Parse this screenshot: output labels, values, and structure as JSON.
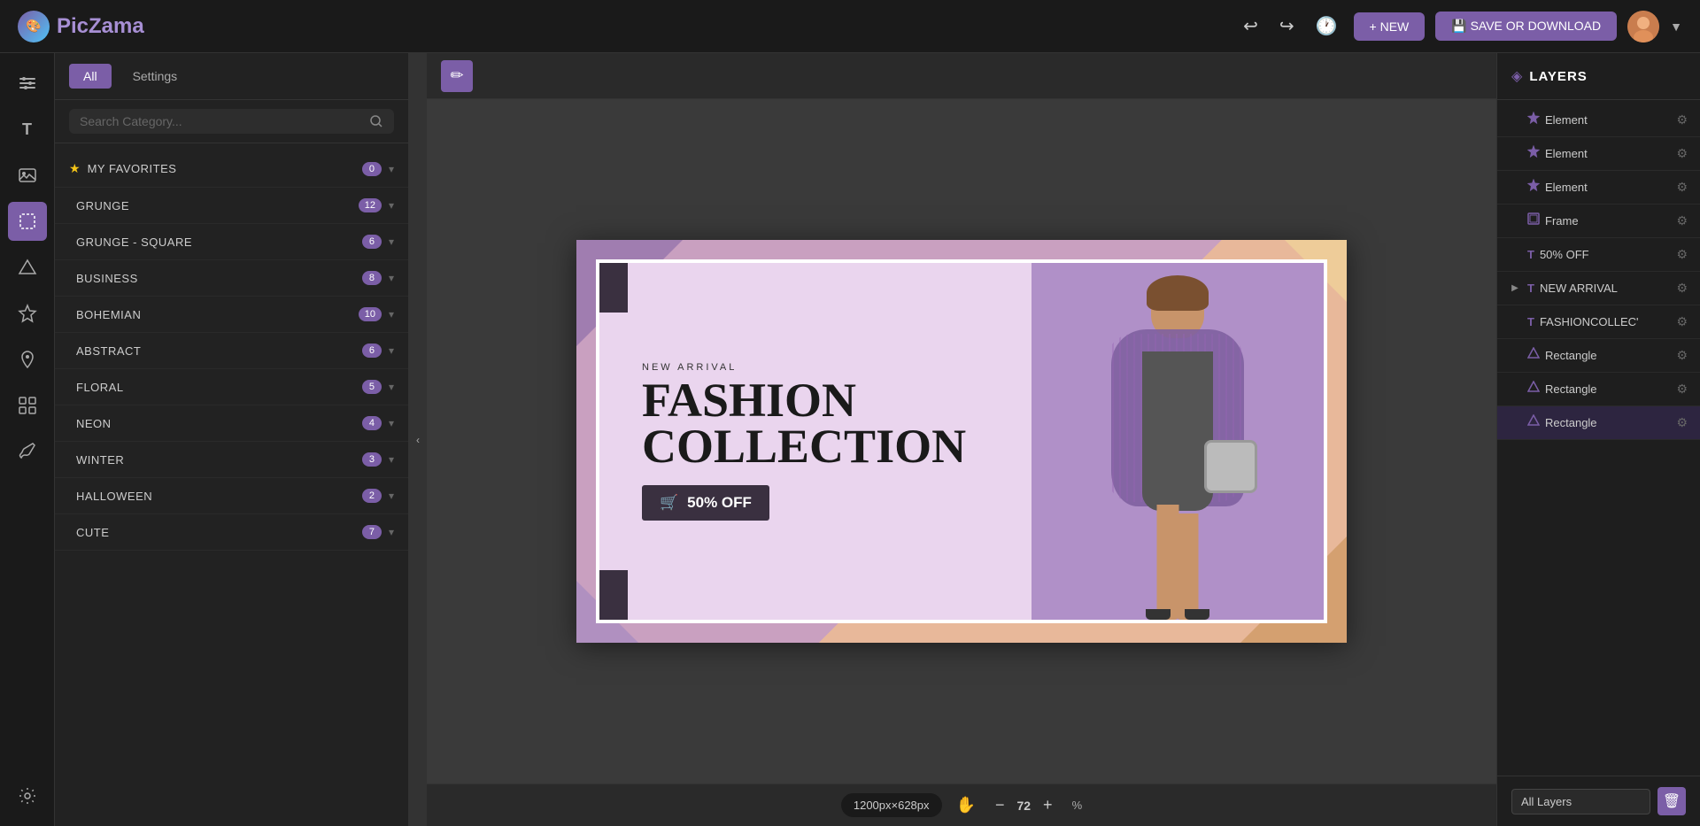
{
  "app": {
    "title": "PicZama",
    "logo_emoji": "🎨"
  },
  "topbar": {
    "undo_label": "↩",
    "redo_label": "↪",
    "history_label": "🕐",
    "new_label": "+ NEW",
    "save_label": "💾 SAVE OR DOWNLOAD",
    "avatar_emoji": "👤"
  },
  "left_rail": {
    "items": [
      {
        "id": "adjust",
        "icon": "⊞",
        "label": "adjust-icon"
      },
      {
        "id": "text",
        "icon": "T",
        "label": "text-icon"
      },
      {
        "id": "image",
        "icon": "🖼",
        "label": "image-icon"
      },
      {
        "id": "select",
        "icon": "⬚",
        "label": "select-icon"
      },
      {
        "id": "shapes",
        "icon": "▲",
        "label": "shapes-icon"
      },
      {
        "id": "star",
        "icon": "★",
        "label": "star-icon"
      },
      {
        "id": "location",
        "icon": "📍",
        "label": "location-icon"
      },
      {
        "id": "grid",
        "icon": "⊞",
        "label": "grid-icon"
      },
      {
        "id": "brush",
        "icon": "✏",
        "label": "brush-icon"
      }
    ],
    "settings_icon": "⚙"
  },
  "left_panel": {
    "tabs": {
      "all_label": "All",
      "settings_label": "Settings"
    },
    "search_placeholder": "Search Category...",
    "categories": [
      {
        "id": "favorites",
        "name": "MY FAVORITES",
        "count": 0,
        "has_star": true
      },
      {
        "id": "grunge",
        "name": "GRUNGE",
        "count": 12,
        "has_star": false
      },
      {
        "id": "grunge-square",
        "name": "GRUNGE - SQUARE",
        "count": 6,
        "has_star": false
      },
      {
        "id": "business",
        "name": "BUSINESS",
        "count": 8,
        "has_star": false
      },
      {
        "id": "bohemian",
        "name": "BOHEMIAN",
        "count": 10,
        "has_star": false
      },
      {
        "id": "abstract",
        "name": "ABSTRACT",
        "count": 6,
        "has_star": false
      },
      {
        "id": "floral",
        "name": "FLORAL",
        "count": 5,
        "has_star": false
      },
      {
        "id": "neon",
        "name": "NEON",
        "count": 4,
        "has_star": false
      },
      {
        "id": "winter",
        "name": "WINTER",
        "count": 3,
        "has_star": false
      },
      {
        "id": "halloween",
        "name": "HALLOWEEN",
        "count": 2,
        "has_star": false
      },
      {
        "id": "cute",
        "name": "CUTE",
        "count": 7,
        "has_star": false
      }
    ]
  },
  "canvas": {
    "edit_icon": "✏",
    "design": {
      "sub_title": "NEW ARRIVAL",
      "title_line1": "FASHION",
      "title_line2": "COLLECTION",
      "cta_text": "50% OFF",
      "cart_icon": "🛒"
    },
    "size_label": "1200px×628px",
    "hand_icon": "✋",
    "zoom_minus": "−",
    "zoom_value": "72",
    "zoom_plus": "+",
    "zoom_pct": "%"
  },
  "layers_panel": {
    "title": "LAYERS",
    "stack_icon": "◈",
    "items": [
      {
        "id": "element1",
        "type": "star",
        "type_icon": "★",
        "name": "Element",
        "selected": false,
        "expandable": false
      },
      {
        "id": "element2",
        "type": "star",
        "type_icon": "★",
        "name": "Element",
        "selected": false,
        "expandable": false
      },
      {
        "id": "element3",
        "type": "star",
        "type_icon": "★",
        "name": "Element",
        "selected": false,
        "expandable": false
      },
      {
        "id": "frame1",
        "type": "frame",
        "type_icon": "⬚",
        "name": "Frame",
        "selected": false,
        "expandable": false
      },
      {
        "id": "text-50off",
        "type": "text",
        "type_icon": "T",
        "name": "50% OFF",
        "selected": false,
        "expandable": false
      },
      {
        "id": "text-newarrival",
        "type": "text",
        "type_icon": "T",
        "name": "NEW ARRIVAL",
        "selected": false,
        "expandable": true
      },
      {
        "id": "text-fashioncollec",
        "type": "text",
        "type_icon": "T",
        "name": "FASHIONCOLLEC'",
        "selected": false,
        "expandable": false
      },
      {
        "id": "rect1",
        "type": "rect",
        "type_icon": "▲",
        "name": "Rectangle",
        "selected": false,
        "expandable": false
      },
      {
        "id": "rect2",
        "type": "rect",
        "type_icon": "▲",
        "name": "Rectangle",
        "selected": false,
        "expandable": false
      },
      {
        "id": "rect3",
        "type": "rect",
        "type_icon": "▲",
        "name": "Rectangle",
        "selected": true,
        "expandable": false
      }
    ],
    "footer": {
      "select_label": "All Layers",
      "delete_icon": "🗑"
    }
  }
}
